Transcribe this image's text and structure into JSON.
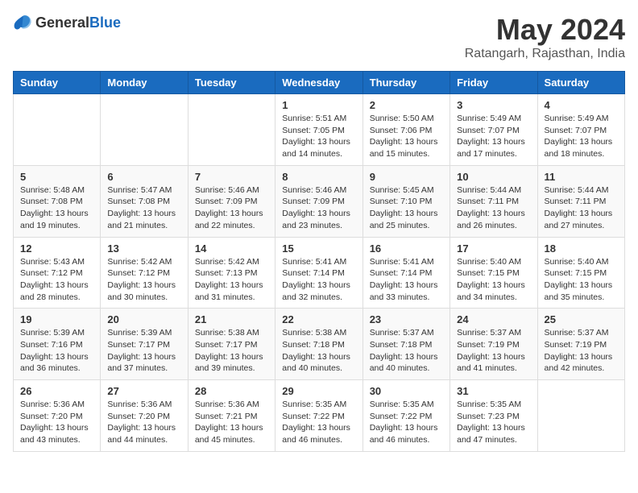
{
  "header": {
    "logo_general": "General",
    "logo_blue": "Blue",
    "title": "May 2024",
    "location": "Ratangarh, Rajasthan, India"
  },
  "days_of_week": [
    "Sunday",
    "Monday",
    "Tuesday",
    "Wednesday",
    "Thursday",
    "Friday",
    "Saturday"
  ],
  "weeks": [
    [
      {
        "day": "",
        "info": ""
      },
      {
        "day": "",
        "info": ""
      },
      {
        "day": "",
        "info": ""
      },
      {
        "day": "1",
        "info": "Sunrise: 5:51 AM\nSunset: 7:05 PM\nDaylight: 13 hours and 14 minutes."
      },
      {
        "day": "2",
        "info": "Sunrise: 5:50 AM\nSunset: 7:06 PM\nDaylight: 13 hours and 15 minutes."
      },
      {
        "day": "3",
        "info": "Sunrise: 5:49 AM\nSunset: 7:07 PM\nDaylight: 13 hours and 17 minutes."
      },
      {
        "day": "4",
        "info": "Sunrise: 5:49 AM\nSunset: 7:07 PM\nDaylight: 13 hours and 18 minutes."
      }
    ],
    [
      {
        "day": "5",
        "info": "Sunrise: 5:48 AM\nSunset: 7:08 PM\nDaylight: 13 hours and 19 minutes."
      },
      {
        "day": "6",
        "info": "Sunrise: 5:47 AM\nSunset: 7:08 PM\nDaylight: 13 hours and 21 minutes."
      },
      {
        "day": "7",
        "info": "Sunrise: 5:46 AM\nSunset: 7:09 PM\nDaylight: 13 hours and 22 minutes."
      },
      {
        "day": "8",
        "info": "Sunrise: 5:46 AM\nSunset: 7:09 PM\nDaylight: 13 hours and 23 minutes."
      },
      {
        "day": "9",
        "info": "Sunrise: 5:45 AM\nSunset: 7:10 PM\nDaylight: 13 hours and 25 minutes."
      },
      {
        "day": "10",
        "info": "Sunrise: 5:44 AM\nSunset: 7:11 PM\nDaylight: 13 hours and 26 minutes."
      },
      {
        "day": "11",
        "info": "Sunrise: 5:44 AM\nSunset: 7:11 PM\nDaylight: 13 hours and 27 minutes."
      }
    ],
    [
      {
        "day": "12",
        "info": "Sunrise: 5:43 AM\nSunset: 7:12 PM\nDaylight: 13 hours and 28 minutes."
      },
      {
        "day": "13",
        "info": "Sunrise: 5:42 AM\nSunset: 7:12 PM\nDaylight: 13 hours and 30 minutes."
      },
      {
        "day": "14",
        "info": "Sunrise: 5:42 AM\nSunset: 7:13 PM\nDaylight: 13 hours and 31 minutes."
      },
      {
        "day": "15",
        "info": "Sunrise: 5:41 AM\nSunset: 7:14 PM\nDaylight: 13 hours and 32 minutes."
      },
      {
        "day": "16",
        "info": "Sunrise: 5:41 AM\nSunset: 7:14 PM\nDaylight: 13 hours and 33 minutes."
      },
      {
        "day": "17",
        "info": "Sunrise: 5:40 AM\nSunset: 7:15 PM\nDaylight: 13 hours and 34 minutes."
      },
      {
        "day": "18",
        "info": "Sunrise: 5:40 AM\nSunset: 7:15 PM\nDaylight: 13 hours and 35 minutes."
      }
    ],
    [
      {
        "day": "19",
        "info": "Sunrise: 5:39 AM\nSunset: 7:16 PM\nDaylight: 13 hours and 36 minutes."
      },
      {
        "day": "20",
        "info": "Sunrise: 5:39 AM\nSunset: 7:17 PM\nDaylight: 13 hours and 37 minutes."
      },
      {
        "day": "21",
        "info": "Sunrise: 5:38 AM\nSunset: 7:17 PM\nDaylight: 13 hours and 39 minutes."
      },
      {
        "day": "22",
        "info": "Sunrise: 5:38 AM\nSunset: 7:18 PM\nDaylight: 13 hours and 40 minutes."
      },
      {
        "day": "23",
        "info": "Sunrise: 5:37 AM\nSunset: 7:18 PM\nDaylight: 13 hours and 40 minutes."
      },
      {
        "day": "24",
        "info": "Sunrise: 5:37 AM\nSunset: 7:19 PM\nDaylight: 13 hours and 41 minutes."
      },
      {
        "day": "25",
        "info": "Sunrise: 5:37 AM\nSunset: 7:19 PM\nDaylight: 13 hours and 42 minutes."
      }
    ],
    [
      {
        "day": "26",
        "info": "Sunrise: 5:36 AM\nSunset: 7:20 PM\nDaylight: 13 hours and 43 minutes."
      },
      {
        "day": "27",
        "info": "Sunrise: 5:36 AM\nSunset: 7:20 PM\nDaylight: 13 hours and 44 minutes."
      },
      {
        "day": "28",
        "info": "Sunrise: 5:36 AM\nSunset: 7:21 PM\nDaylight: 13 hours and 45 minutes."
      },
      {
        "day": "29",
        "info": "Sunrise: 5:35 AM\nSunset: 7:22 PM\nDaylight: 13 hours and 46 minutes."
      },
      {
        "day": "30",
        "info": "Sunrise: 5:35 AM\nSunset: 7:22 PM\nDaylight: 13 hours and 46 minutes."
      },
      {
        "day": "31",
        "info": "Sunrise: 5:35 AM\nSunset: 7:23 PM\nDaylight: 13 hours and 47 minutes."
      },
      {
        "day": "",
        "info": ""
      }
    ]
  ]
}
